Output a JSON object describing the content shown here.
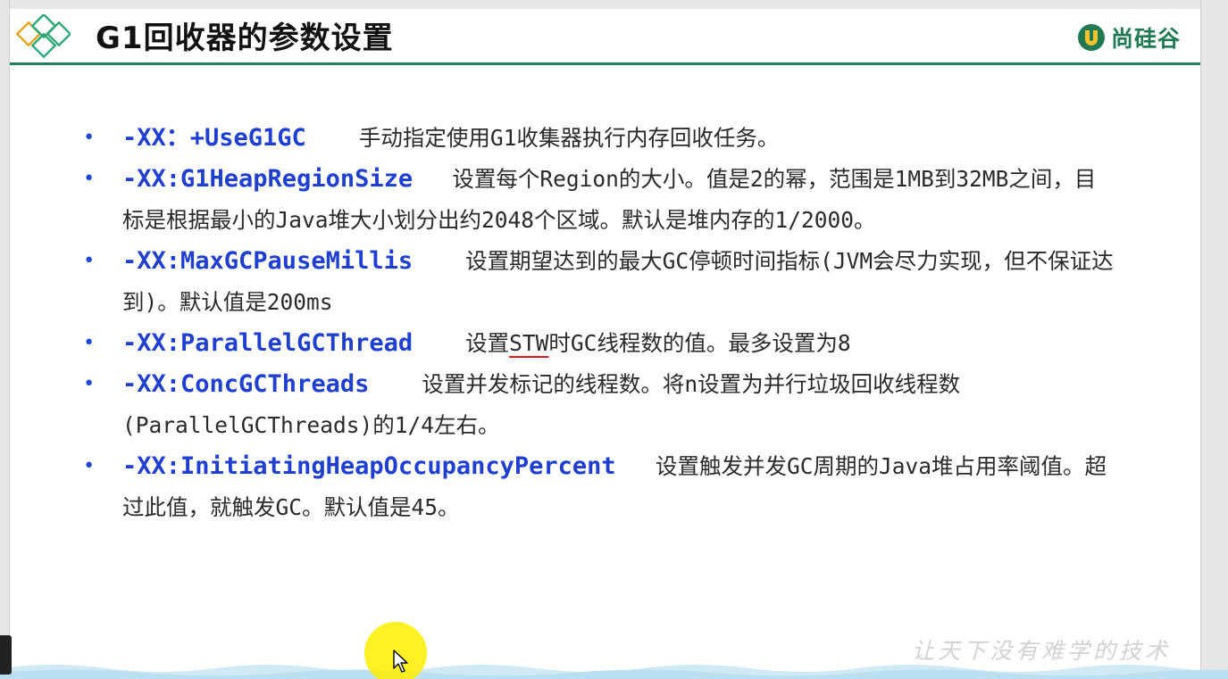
{
  "slide": {
    "title": "G1回收器的参数设置",
    "brand_name": "尚硅谷",
    "watermark": "让天下没有难学的技术"
  },
  "items": [
    {
      "bullet": "•",
      "param": "-XX：+UseG1GC",
      "desc": "手动指定使用G1收集器执行内存回收任务。"
    },
    {
      "bullet": "•",
      "param": "-XX:G1HeapRegionSize",
      "desc": "设置每个Region的大小。值是2的幂，范围是1MB到32MB之间，目标是根据最小的Java堆大小划分出约2048个区域。默认是堆内存的1/2000。"
    },
    {
      "bullet": "•",
      "param": "-XX:MaxGCPauseMillis",
      "desc": "设置期望达到的最大GC停顿时间指标(JVM会尽力实现，但不保证达到)。默认值是200ms"
    },
    {
      "bullet": "•",
      "param": "-XX:ParallelGCThread",
      "desc_before": "设置",
      "desc_highlight": "STW",
      "desc_after": "时GC线程数的值。最多设置为8"
    },
    {
      "bullet": "•",
      "param": "-XX:ConcGCThreads",
      "desc": "设置并发标记的线程数。将n设置为并行垃圾回收线程数(ParallelGCThreads)的1/4左右。"
    },
    {
      "bullet": "•",
      "param": "-XX:InitiatingHeapOccupancyPercent",
      "desc": "设置触发并发GC周期的Java堆占用率阈值。超过此值，就触发GC。默认值是45。"
    }
  ],
  "colors": {
    "param": "#1e3fd0",
    "rule": "#1f7f5c",
    "brand": "#1f7a54",
    "stw_underline": "#e11b1b",
    "cursor_highlight": "#ffee00"
  },
  "icons": {
    "logo": "diamond-logo-icon",
    "brand": "brand-mark-icon",
    "cursor": "mouse-pointer-icon"
  }
}
